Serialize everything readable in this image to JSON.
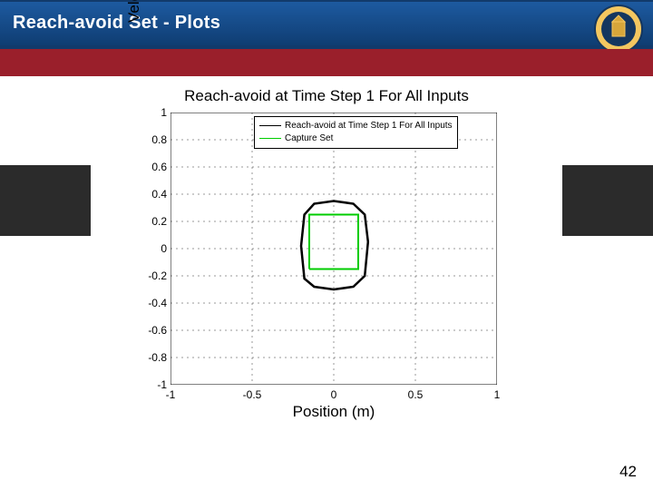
{
  "header": {
    "title": "Reach-avoid Set - Plots"
  },
  "slide": {
    "page_number": "42"
  },
  "chart_data": {
    "type": "line",
    "title": "Reach-avoid at Time Step 1 For All Inputs",
    "xlabel": "Position (m)",
    "ylabel": "Velocity (m/s)",
    "xlim": [
      -1,
      1
    ],
    "ylim": [
      -1,
      1
    ],
    "xticks": [
      -1,
      -0.5,
      0,
      0.5,
      1
    ],
    "yticks": [
      -1,
      -0.8,
      -0.6,
      -0.4,
      -0.2,
      0,
      0.2,
      0.4,
      0.6,
      0.8,
      1
    ],
    "xtick_labels": [
      "-1",
      "-0.5",
      "0",
      "0.5",
      "1"
    ],
    "ytick_labels": [
      "-1",
      "-0.8",
      "-0.6",
      "-0.4",
      "-0.2",
      "0",
      "0.2",
      "0.4",
      "0.6",
      "0.8",
      "1"
    ],
    "grid": true,
    "legend": {
      "position": "top-inside",
      "entries": [
        {
          "name": "Reach-avoid at Time Step 1 For All Inputs",
          "color": "#000000"
        },
        {
          "name": "Capture Set",
          "color": "#00cc00"
        }
      ]
    },
    "series": [
      {
        "name": "Capture Set",
        "color": "#00cc00",
        "shape": "rectangle",
        "x": [
          -0.15,
          0.15,
          0.15,
          -0.15,
          -0.15
        ],
        "y": [
          -0.15,
          -0.15,
          0.25,
          0.25,
          -0.15
        ]
      },
      {
        "name": "Reach-avoid at Time Step 1 For All Inputs",
        "color": "#000000",
        "shape": "closed-curve",
        "x": [
          -0.18,
          -0.12,
          0.0,
          0.12,
          0.19,
          0.21,
          0.19,
          0.12,
          0.0,
          -0.12,
          -0.18,
          -0.2,
          -0.18
        ],
        "y": [
          -0.22,
          -0.28,
          -0.3,
          -0.28,
          -0.2,
          0.05,
          0.25,
          0.33,
          0.35,
          0.33,
          0.25,
          0.02,
          -0.22
        ]
      }
    ]
  }
}
